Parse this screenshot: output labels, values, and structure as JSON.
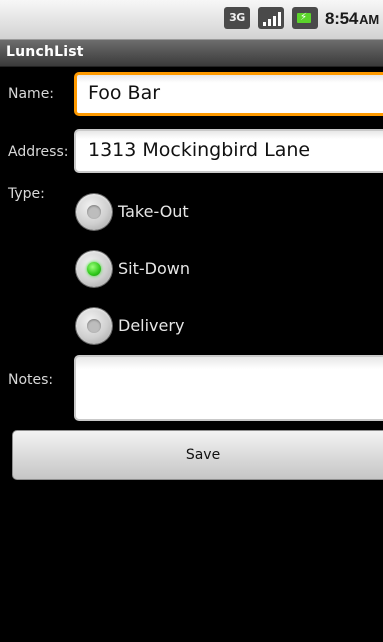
{
  "status_bar": {
    "network": "3G",
    "time": "8:54",
    "ampm": "AM",
    "signal_icon": "signal-bars-icon",
    "battery_icon": "battery-charging-icon"
  },
  "app": {
    "title": "LunchList"
  },
  "form": {
    "name_label": "Name:",
    "name_value": "Foo Bar",
    "address_label": "Address:",
    "address_value": "1313 Mockingbird Lane",
    "type_label": "Type:",
    "types": [
      {
        "label": "Take-Out",
        "checked": false
      },
      {
        "label": "Sit-Down",
        "checked": true
      },
      {
        "label": "Delivery",
        "checked": false
      }
    ],
    "notes_label": "Notes:",
    "notes_value": "",
    "save_label": "Save"
  },
  "colors": {
    "focus_border": "#ff9a00",
    "radio_checked": "#2fc81a",
    "background": "#000000"
  }
}
